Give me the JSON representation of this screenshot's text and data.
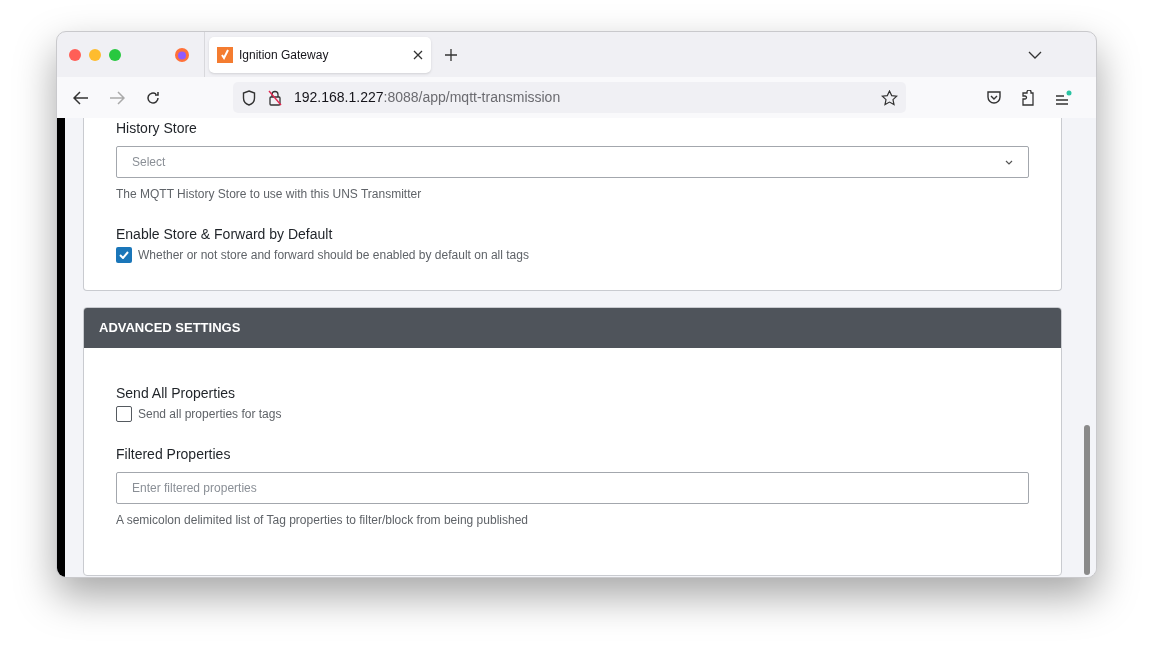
{
  "browser": {
    "tabs": [
      {
        "title": "Ignition Gateway",
        "selected": true
      }
    ],
    "address": {
      "host": "192.168.1.227",
      "path": ":8088/app/mqtt-transmission"
    }
  },
  "sections": [
    {
      "fields": [
        {
          "kind": "select",
          "label": "History Store",
          "placeholder": "Select",
          "help": "The MQTT History Store to use with this UNS Transmitter"
        },
        {
          "kind": "checkbox",
          "label": "Enable Store & Forward by Default",
          "checked": true,
          "description": "Whether or not store and forward should be enabled by default on all tags"
        }
      ]
    },
    {
      "header": "ADVANCED SETTINGS",
      "fields": [
        {
          "kind": "checkbox",
          "label": "Send All Properties",
          "checked": false,
          "description": "Send all properties for tags"
        },
        {
          "kind": "text",
          "label": "Filtered Properties",
          "placeholder": "Enter filtered properties",
          "help": "A semicolon delimited list of Tag properties to filter/block from being published"
        }
      ]
    }
  ]
}
